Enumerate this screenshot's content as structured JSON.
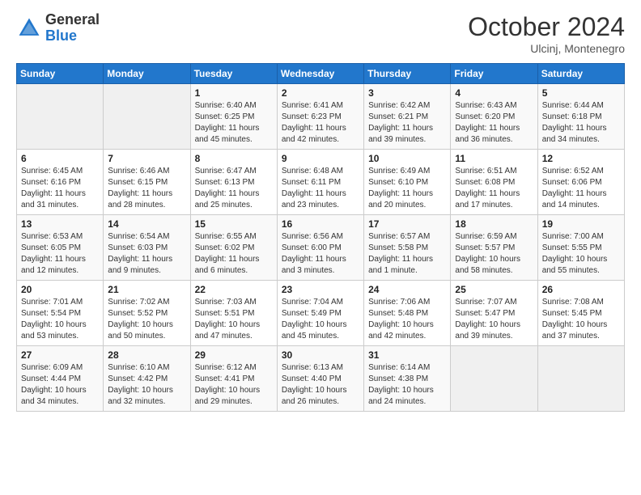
{
  "logo": {
    "general": "General",
    "blue": "Blue"
  },
  "header": {
    "month": "October 2024",
    "location": "Ulcinj, Montenegro"
  },
  "weekdays": [
    "Sunday",
    "Monday",
    "Tuesday",
    "Wednesday",
    "Thursday",
    "Friday",
    "Saturday"
  ],
  "weeks": [
    [
      {
        "day": "",
        "detail": ""
      },
      {
        "day": "",
        "detail": ""
      },
      {
        "day": "1",
        "detail": "Sunrise: 6:40 AM\nSunset: 6:25 PM\nDaylight: 11 hours and 45 minutes."
      },
      {
        "day": "2",
        "detail": "Sunrise: 6:41 AM\nSunset: 6:23 PM\nDaylight: 11 hours and 42 minutes."
      },
      {
        "day": "3",
        "detail": "Sunrise: 6:42 AM\nSunset: 6:21 PM\nDaylight: 11 hours and 39 minutes."
      },
      {
        "day": "4",
        "detail": "Sunrise: 6:43 AM\nSunset: 6:20 PM\nDaylight: 11 hours and 36 minutes."
      },
      {
        "day": "5",
        "detail": "Sunrise: 6:44 AM\nSunset: 6:18 PM\nDaylight: 11 hours and 34 minutes."
      }
    ],
    [
      {
        "day": "6",
        "detail": "Sunrise: 6:45 AM\nSunset: 6:16 PM\nDaylight: 11 hours and 31 minutes."
      },
      {
        "day": "7",
        "detail": "Sunrise: 6:46 AM\nSunset: 6:15 PM\nDaylight: 11 hours and 28 minutes."
      },
      {
        "day": "8",
        "detail": "Sunrise: 6:47 AM\nSunset: 6:13 PM\nDaylight: 11 hours and 25 minutes."
      },
      {
        "day": "9",
        "detail": "Sunrise: 6:48 AM\nSunset: 6:11 PM\nDaylight: 11 hours and 23 minutes."
      },
      {
        "day": "10",
        "detail": "Sunrise: 6:49 AM\nSunset: 6:10 PM\nDaylight: 11 hours and 20 minutes."
      },
      {
        "day": "11",
        "detail": "Sunrise: 6:51 AM\nSunset: 6:08 PM\nDaylight: 11 hours and 17 minutes."
      },
      {
        "day": "12",
        "detail": "Sunrise: 6:52 AM\nSunset: 6:06 PM\nDaylight: 11 hours and 14 minutes."
      }
    ],
    [
      {
        "day": "13",
        "detail": "Sunrise: 6:53 AM\nSunset: 6:05 PM\nDaylight: 11 hours and 12 minutes."
      },
      {
        "day": "14",
        "detail": "Sunrise: 6:54 AM\nSunset: 6:03 PM\nDaylight: 11 hours and 9 minutes."
      },
      {
        "day": "15",
        "detail": "Sunrise: 6:55 AM\nSunset: 6:02 PM\nDaylight: 11 hours and 6 minutes."
      },
      {
        "day": "16",
        "detail": "Sunrise: 6:56 AM\nSunset: 6:00 PM\nDaylight: 11 hours and 3 minutes."
      },
      {
        "day": "17",
        "detail": "Sunrise: 6:57 AM\nSunset: 5:58 PM\nDaylight: 11 hours and 1 minute."
      },
      {
        "day": "18",
        "detail": "Sunrise: 6:59 AM\nSunset: 5:57 PM\nDaylight: 10 hours and 58 minutes."
      },
      {
        "day": "19",
        "detail": "Sunrise: 7:00 AM\nSunset: 5:55 PM\nDaylight: 10 hours and 55 minutes."
      }
    ],
    [
      {
        "day": "20",
        "detail": "Sunrise: 7:01 AM\nSunset: 5:54 PM\nDaylight: 10 hours and 53 minutes."
      },
      {
        "day": "21",
        "detail": "Sunrise: 7:02 AM\nSunset: 5:52 PM\nDaylight: 10 hours and 50 minutes."
      },
      {
        "day": "22",
        "detail": "Sunrise: 7:03 AM\nSunset: 5:51 PM\nDaylight: 10 hours and 47 minutes."
      },
      {
        "day": "23",
        "detail": "Sunrise: 7:04 AM\nSunset: 5:49 PM\nDaylight: 10 hours and 45 minutes."
      },
      {
        "day": "24",
        "detail": "Sunrise: 7:06 AM\nSunset: 5:48 PM\nDaylight: 10 hours and 42 minutes."
      },
      {
        "day": "25",
        "detail": "Sunrise: 7:07 AM\nSunset: 5:47 PM\nDaylight: 10 hours and 39 minutes."
      },
      {
        "day": "26",
        "detail": "Sunrise: 7:08 AM\nSunset: 5:45 PM\nDaylight: 10 hours and 37 minutes."
      }
    ],
    [
      {
        "day": "27",
        "detail": "Sunrise: 6:09 AM\nSunset: 4:44 PM\nDaylight: 10 hours and 34 minutes."
      },
      {
        "day": "28",
        "detail": "Sunrise: 6:10 AM\nSunset: 4:42 PM\nDaylight: 10 hours and 32 minutes."
      },
      {
        "day": "29",
        "detail": "Sunrise: 6:12 AM\nSunset: 4:41 PM\nDaylight: 10 hours and 29 minutes."
      },
      {
        "day": "30",
        "detail": "Sunrise: 6:13 AM\nSunset: 4:40 PM\nDaylight: 10 hours and 26 minutes."
      },
      {
        "day": "31",
        "detail": "Sunrise: 6:14 AM\nSunset: 4:38 PM\nDaylight: 10 hours and 24 minutes."
      },
      {
        "day": "",
        "detail": ""
      },
      {
        "day": "",
        "detail": ""
      }
    ]
  ]
}
